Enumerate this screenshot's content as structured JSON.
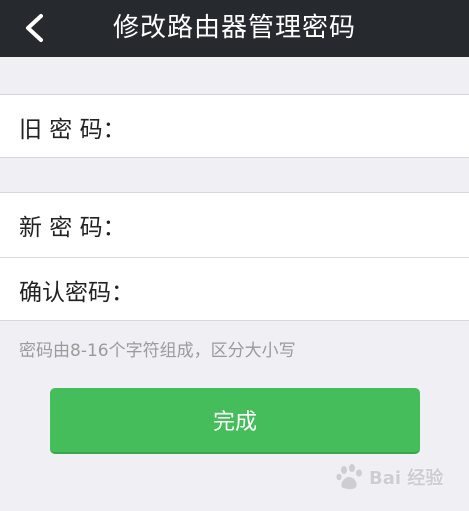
{
  "header": {
    "title": "修改路由器管理密码",
    "back_icon": "chevron-left-icon"
  },
  "form": {
    "old_password": {
      "label": "旧 密 码：",
      "value": "",
      "placeholder": ""
    },
    "new_password": {
      "label": "新 密 码：",
      "value": "",
      "placeholder": ""
    },
    "confirm_password": {
      "label": "确认密码：",
      "value": "",
      "placeholder": ""
    },
    "hint": "密码由8-16个字符组成，区分大小写"
  },
  "actions": {
    "done_label": "完成"
  },
  "watermark": {
    "text": "Bai 经验"
  },
  "colors": {
    "header_bg": "#262a2f",
    "page_bg": "#efeff4",
    "button_green": "#45bd5b",
    "hint_text": "#9b9b9b"
  }
}
